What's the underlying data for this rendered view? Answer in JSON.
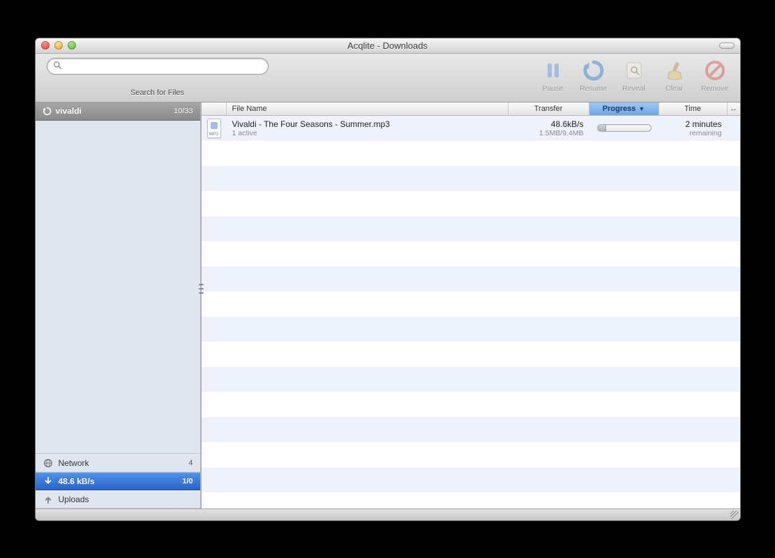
{
  "window": {
    "title": "Acqlite - Downloads"
  },
  "search": {
    "label": "Search for Files",
    "placeholder": ""
  },
  "toolbar": {
    "pause": "Pause",
    "resume": "Resume",
    "reveal": "Reveal",
    "clear": "Clear",
    "remove": "Remove"
  },
  "sidebar": {
    "filter": {
      "term": "vivaldi",
      "count": "10/33"
    },
    "rows": {
      "network": {
        "label": "Network",
        "count": "4"
      },
      "download": {
        "label": "48.6 kB/s",
        "count": "1/0"
      },
      "upload": {
        "label": "Uploads",
        "count": ""
      }
    }
  },
  "table": {
    "headers": {
      "filename": "File Name",
      "transfer": "Transfer",
      "progress": "Progress",
      "time": "Time"
    },
    "row0": {
      "name": "Vivaldi - The Four Seasons - Summer.mp3",
      "status": "1 active",
      "rate": "48.6kB/s",
      "size": "1.5MB/9.4MB",
      "progress_pct": 16,
      "time": "2 minutes",
      "time_sub": "remaining"
    }
  }
}
